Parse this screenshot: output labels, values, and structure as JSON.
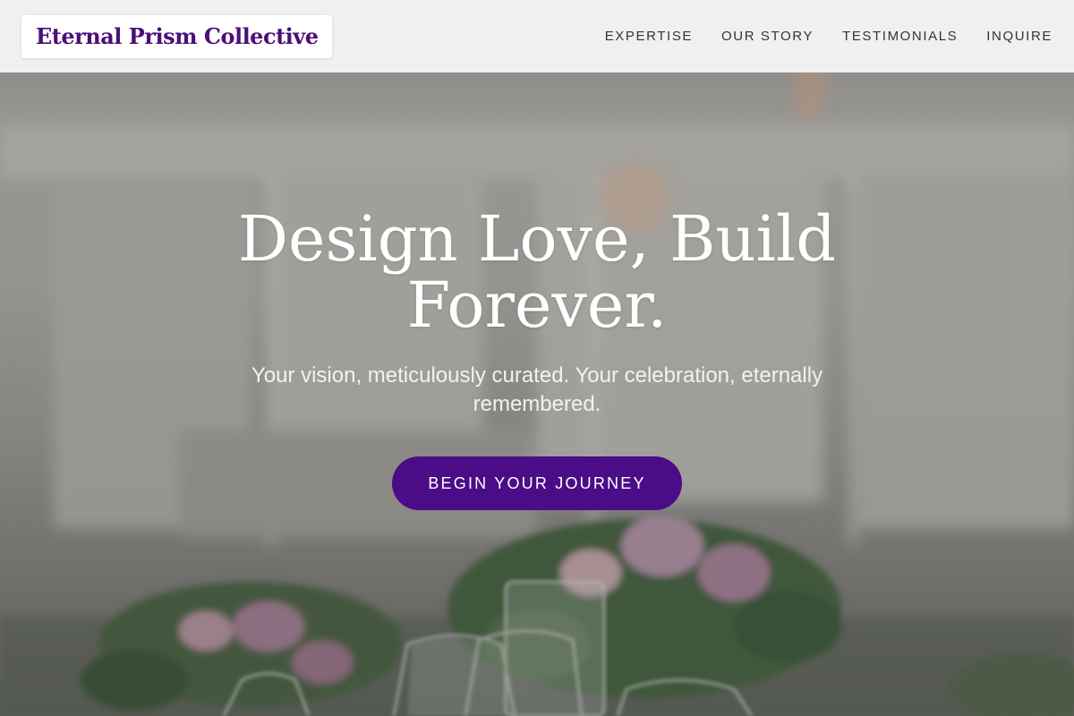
{
  "brand": {
    "name": "Eternal Prism Collective"
  },
  "nav": {
    "items": [
      {
        "label": "EXPERTISE"
      },
      {
        "label": "OUR STORY"
      },
      {
        "label": "TESTIMONIALS"
      },
      {
        "label": "INQUIRE"
      }
    ]
  },
  "hero": {
    "title": "Design Love, Build Forever.",
    "subtitle": "Your vision, meticulously curated. Your celebration, eternally remembered.",
    "cta_label": "BEGIN YOUR JOURNEY"
  },
  "colors": {
    "brand": "#4b0f78",
    "cta_background": "#4b0c88",
    "header_background": "#f5f5f5",
    "nav_text": "#333333"
  }
}
